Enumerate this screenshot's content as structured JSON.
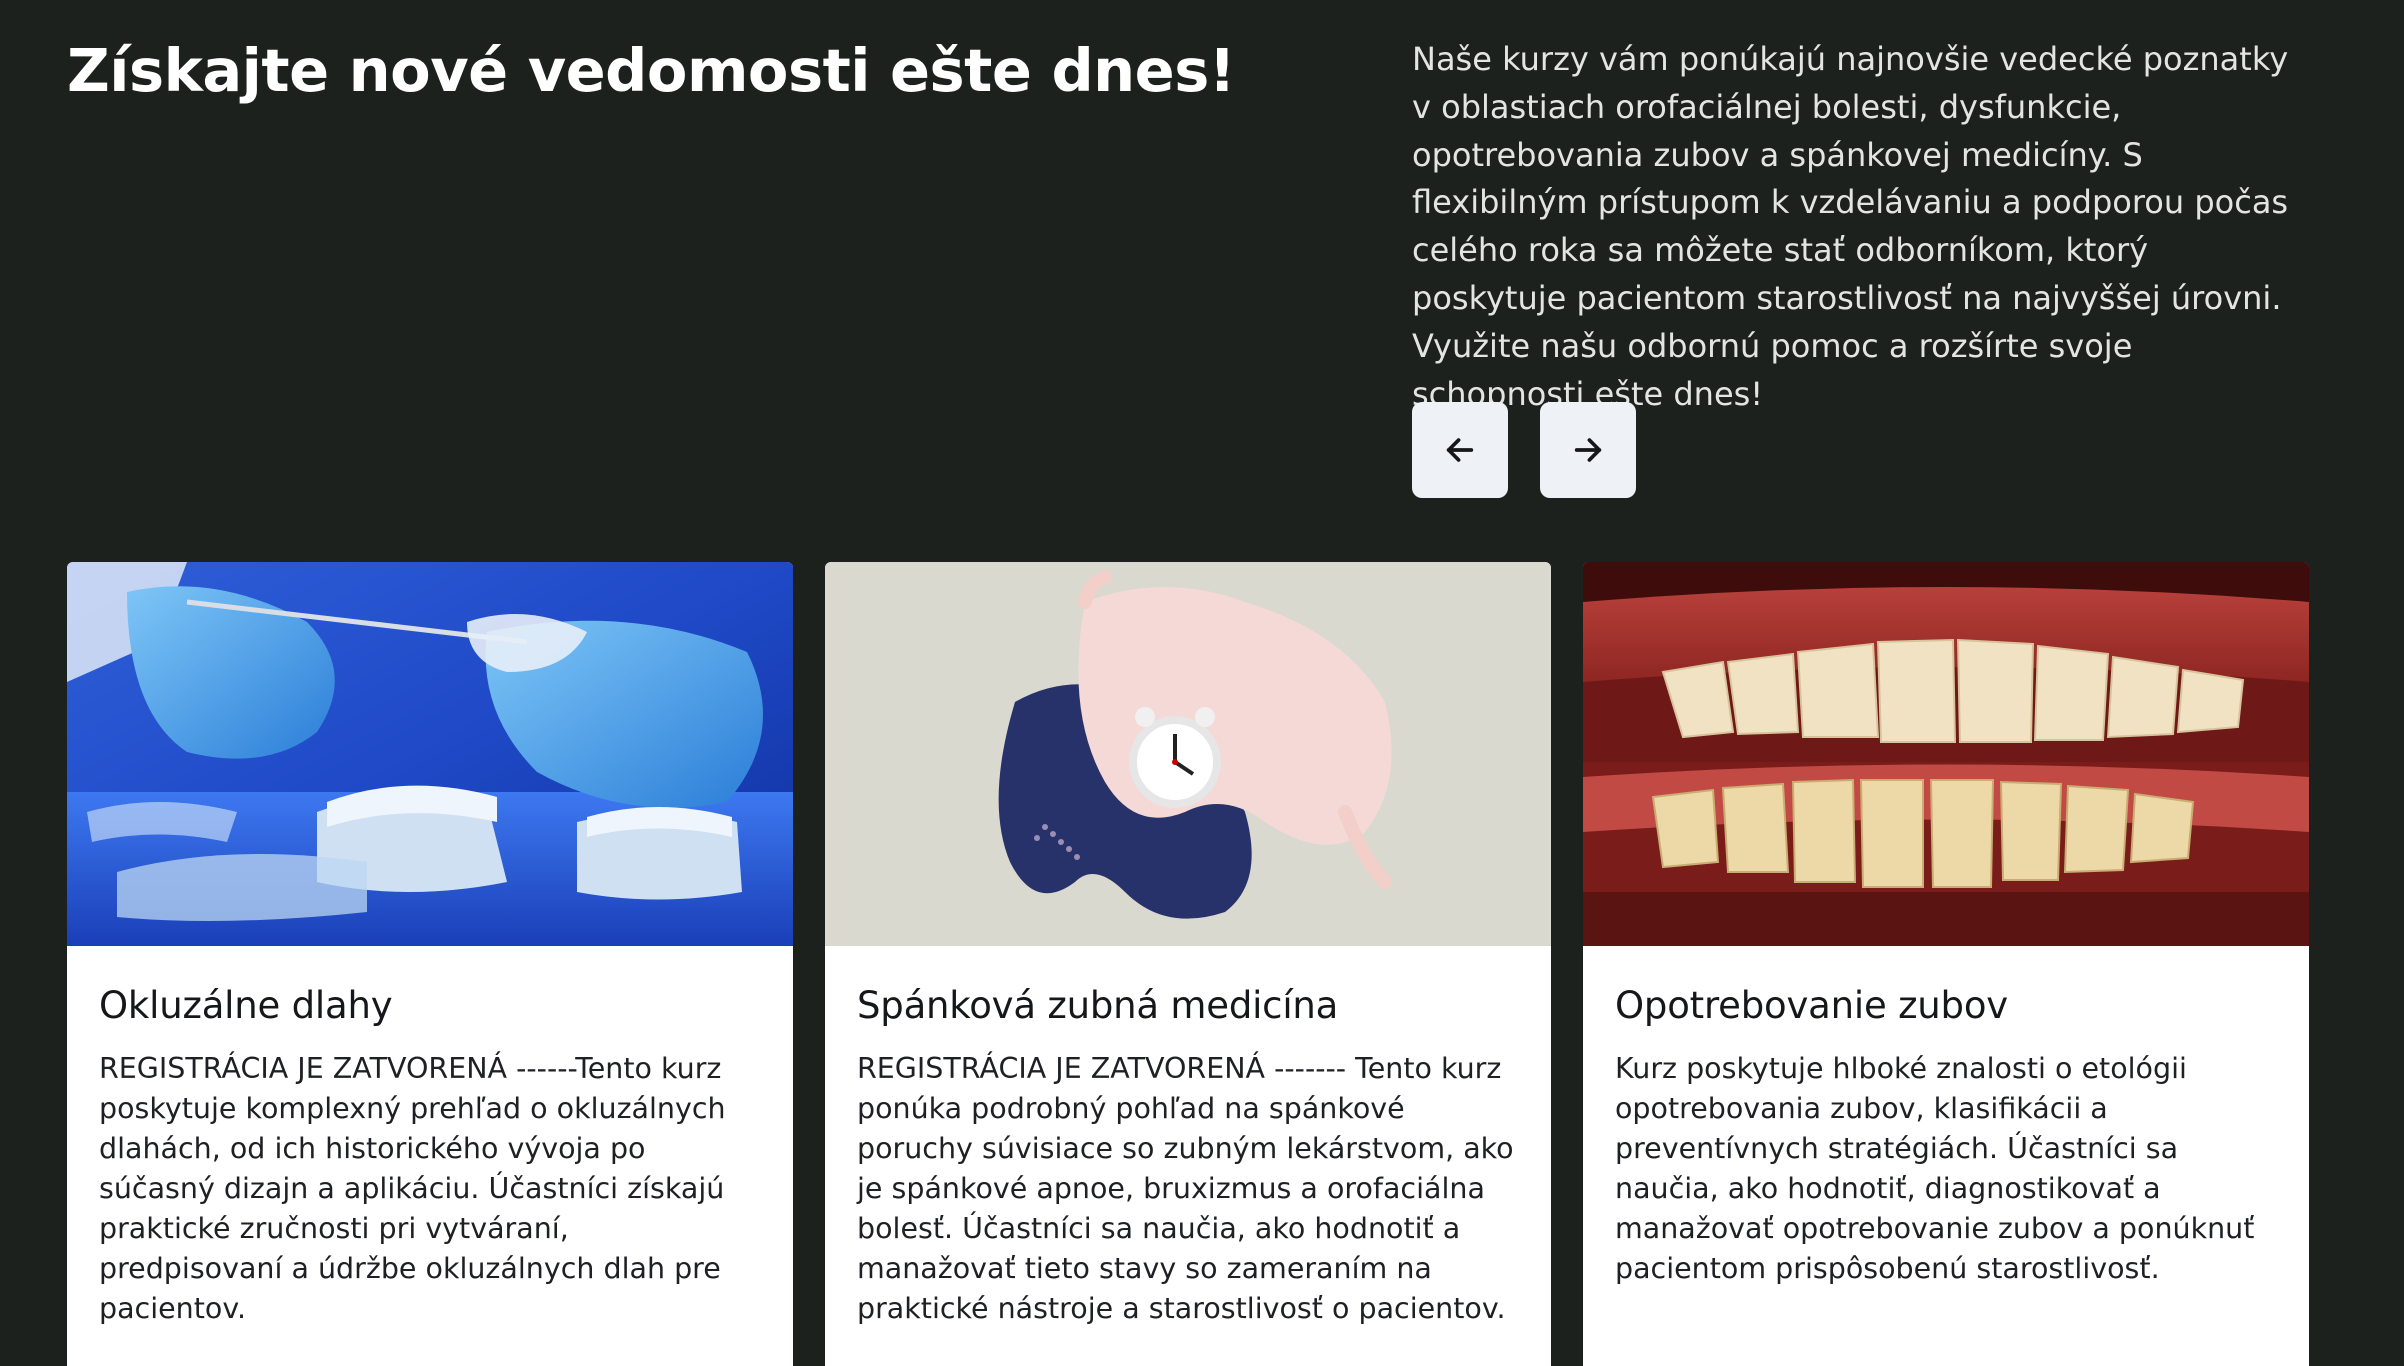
{
  "hero": {
    "title": "Získajte nové vedomosti ešte dnes!",
    "description": "Naše kurzy vám ponúkajú najnovšie vedecké poznatky v oblastiach orofaciálnej bolesti, dysfunkcie, opotrebovania zubov a spánkovej medicíny. S flexibilným prístupom k vzdelávaniu a podporou počas celého roka sa môžete stať odborníkom, ktorý poskytuje pacientom starostlivosť na najvyššej úrovni. Využite našu odbornú pomoc a rozšírte svoje schopnosti ešte dnes!"
  },
  "carousel": {
    "prev_icon": "arrow-left-icon",
    "next_icon": "arrow-right-icon"
  },
  "courses": [
    {
      "title": "Okluzálne dlahy",
      "text": "REGISTRÁCIA JE ZATVORENÁ ------Tento kurz poskytuje komplexný prehľad o okluzálnych dlahách, od ich historického vývoja po súčasný dizajn a aplikáciu. Účastníci získajú praktické zručnosti pri vytváraní, predpisovaní a údržbe okluzálnych dlah pre pacientov.",
      "image": "dental-splint-models-photo"
    },
    {
      "title": "Spánková zubná medicína",
      "text": "REGISTRÁCIA JE ZATVORENÁ ------- Tento kurz ponúka podrobný pohľad na spánkové poruchy súvisiace so zubným lekárstvom, ako je spánkové apnoe, bruxizmus a orofaciálna bolesť. Účastníci sa naučia, ako hodnotiť a manažovať tieto stavy so zameraním na praktické nástroje a starostlivosť o pacientov.",
      "image": "sleep-mask-alarm-clock-photo"
    },
    {
      "title": "Opotrebovanie zubov",
      "text": "Kurz poskytuje hlboké znalosti o etológii opotrebovania zubov, klasifikácii a preventívnych stratégiách. Účastníci sa naučia, ako hodnotiť, diagnostikovať a manažovať opotrebovanie zubov a ponúknuť pacientom prispôsobenú starostlivosť.",
      "image": "worn-teeth-closeup-photo"
    }
  ],
  "colors": {
    "background": "#1c211e",
    "button_bg": "#eef1f6",
    "card_bg": "#ffffff"
  }
}
